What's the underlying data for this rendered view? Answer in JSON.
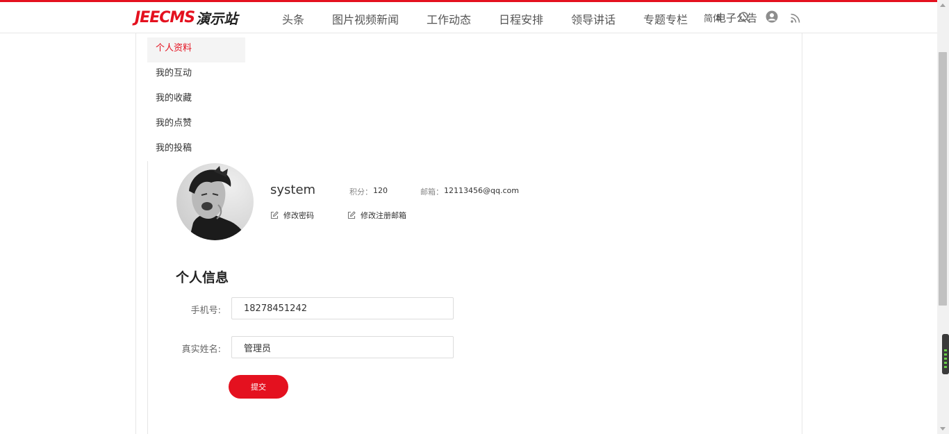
{
  "colors": {
    "brand": "#e4111f",
    "border": "#e6e6e6",
    "menu_active_bg": "#f4f4f4"
  },
  "header": {
    "logo_latin": "JEECMS",
    "logo_cjk": "演示站",
    "nav": [
      "头条",
      "图片视频新闻",
      "工作动态",
      "日程安排",
      "领导讲话",
      "专题专栏"
    ],
    "overlap_a": "简体",
    "overlap_b": "电子公告",
    "icons": [
      "search-icon",
      "user-icon",
      "rss-icon"
    ]
  },
  "menu": {
    "items": [
      "个人资料",
      "我的互动",
      "我的收藏",
      "我的点赞",
      "我的投稿"
    ],
    "active_index": 0
  },
  "profile": {
    "username": "system",
    "points_label": "积分：",
    "points_value": "120",
    "email_label": "邮箱：",
    "email_value": "12113456@qq.com",
    "change_password": "修改密码",
    "change_email": "修改注册邮箱"
  },
  "form": {
    "title": "个人信息",
    "phone_label": "手机号:",
    "phone_value": "18278451242",
    "name_label": "真实姓名:",
    "name_value": "管理员",
    "submit_label": "提交"
  }
}
